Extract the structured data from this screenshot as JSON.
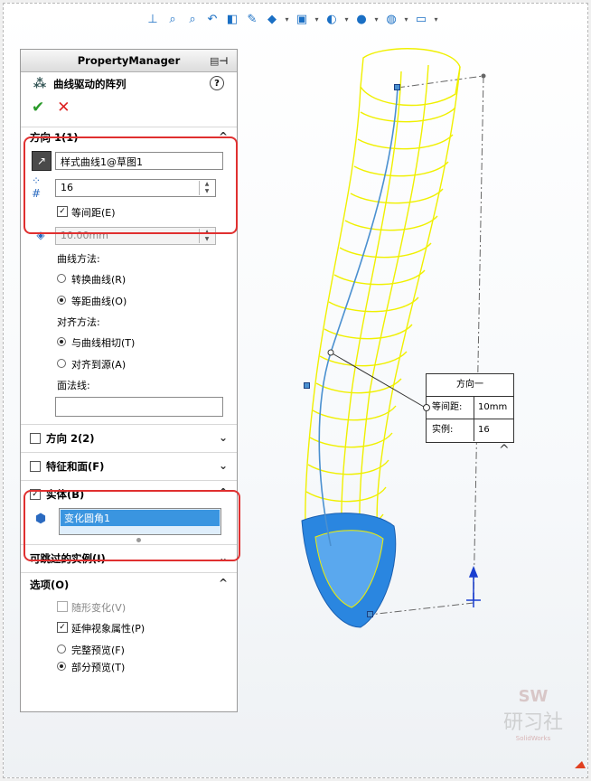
{
  "pm": {
    "title": "PropertyManager",
    "feature_name": "曲线驱动的阵列",
    "help": "?",
    "ok": "✔",
    "cancel": "✕"
  },
  "direction1": {
    "header": "方向 1(1)",
    "curve_value": "样式曲线1@草图1",
    "instances_value": "16",
    "equal_spacing_label": "等间距(E)",
    "equal_spacing_checked": true,
    "spacing_value": "10.00mm",
    "curve_method_label": "曲线方法:",
    "transform_curve_label": "转换曲线(R)",
    "offset_curve_label": "等距曲线(O)",
    "align_method_label": "对齐方法:",
    "tangent_label": "与曲线相切(T)",
    "align_source_label": "对齐到源(A)",
    "face_normal_label": "面法线:",
    "face_normal_value": ""
  },
  "direction2": {
    "header": "方向 2(2)"
  },
  "features_faces": {
    "header": "特征和面(F)"
  },
  "bodies": {
    "header": "实体(B)",
    "item": "变化圆角1"
  },
  "skip_instances": {
    "header": "可跳过的实例(I)"
  },
  "options": {
    "header": "选项(O)",
    "vary_sketch_label": "随形变化(V)",
    "propagate_visual_label": "延伸视象属性(P)",
    "full_preview_label": "完整预览(F)",
    "partial_preview_label": "部分预览(T)"
  },
  "callout": {
    "title": "方向一",
    "spacing_label": "等间距:",
    "spacing_value": "10mm",
    "instances_label": "实例:",
    "instances_value": "16"
  },
  "watermark": {
    "line1": "SW",
    "line2": "研习社",
    "line3": "SolidWorks"
  },
  "colors": {
    "accent": "#3a95e0",
    "highlight_box": "#e03030",
    "preview_yellow": "#f0f000",
    "body_blue": "#2a86e0"
  }
}
